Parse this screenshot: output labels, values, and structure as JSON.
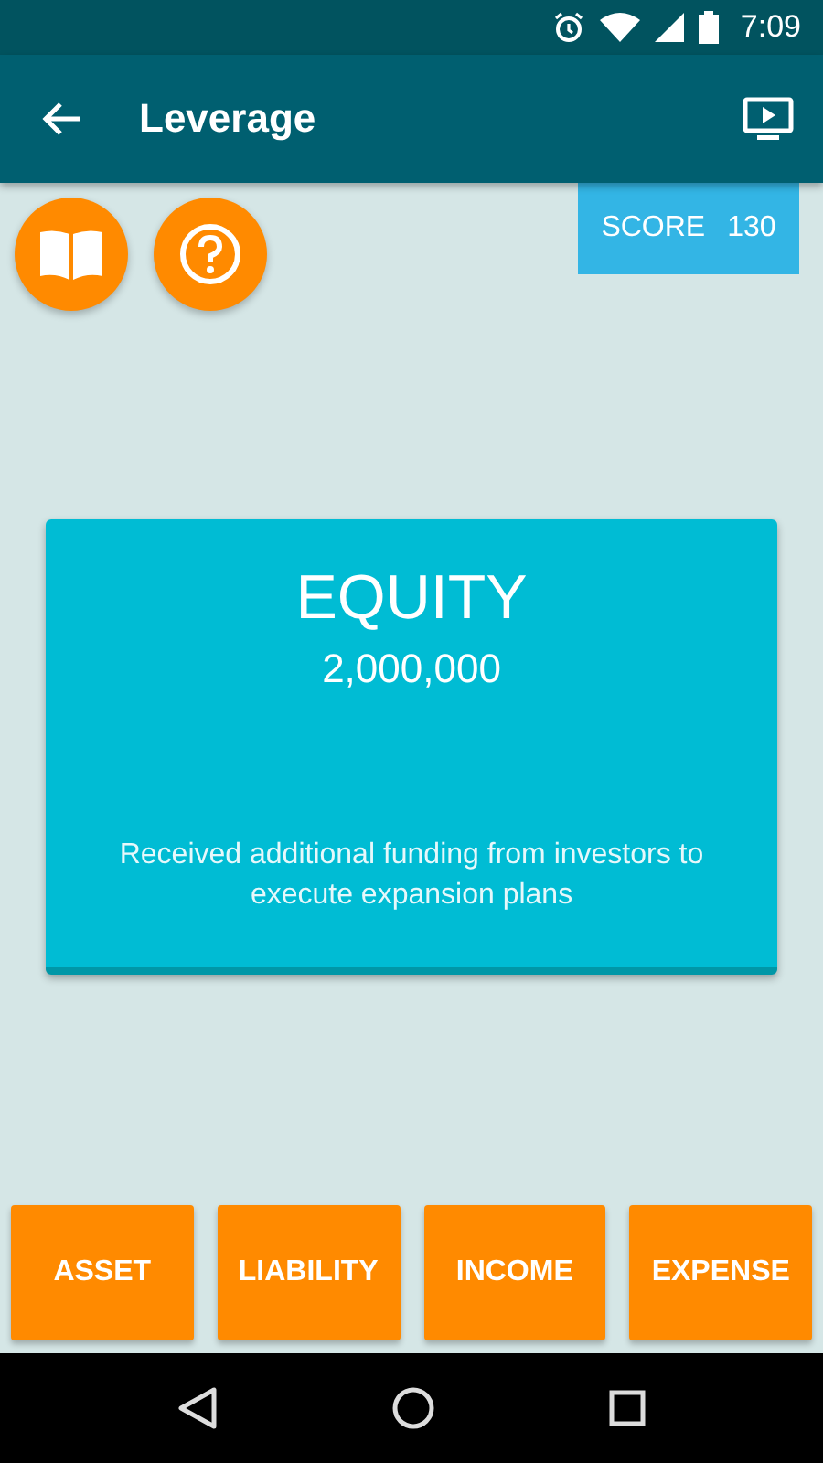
{
  "status_bar": {
    "time": "7:09"
  },
  "app_bar": {
    "title": "Leverage"
  },
  "score": {
    "label": "SCORE",
    "value": "130"
  },
  "card": {
    "title": "EQUITY",
    "amount": "2,000,000",
    "description": "Received additional funding from investors to execute expansion plans"
  },
  "answer_buttons": [
    "ASSET",
    "LIABILITY",
    "INCOME",
    "EXPENSE"
  ]
}
